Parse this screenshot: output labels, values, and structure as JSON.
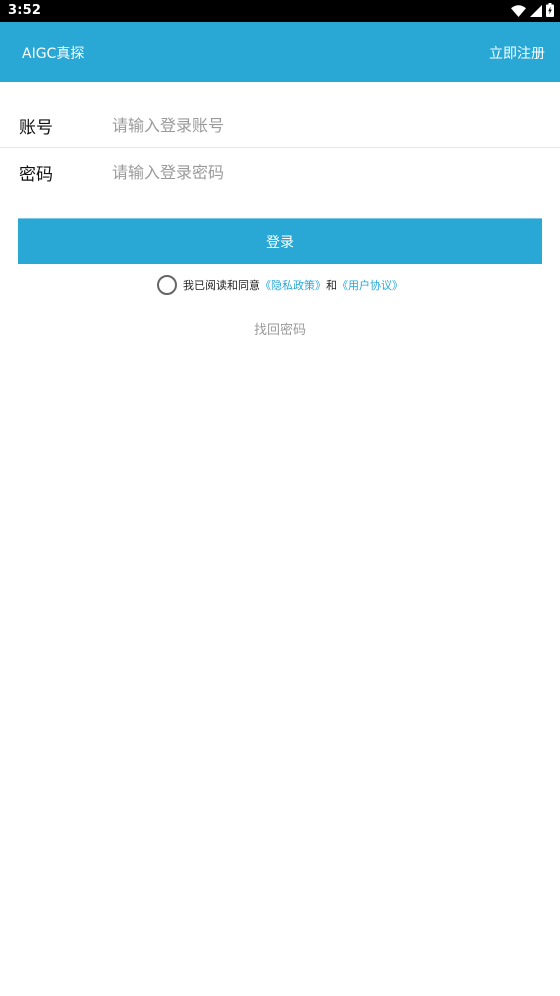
{
  "status_bar": {
    "time": "3:52",
    "icons": [
      "wifi-icon",
      "signal-icon",
      "battery-icon"
    ]
  },
  "app_bar": {
    "title": "AIGC真探",
    "register_label": "立即注册"
  },
  "form": {
    "account": {
      "label": "账号",
      "placeholder": "请输入登录账号",
      "value": ""
    },
    "password": {
      "label": "密码",
      "placeholder": "请输入登录密码",
      "value": ""
    }
  },
  "login_button": "登录",
  "agreement": {
    "checked": false,
    "prefix": "我已阅读和同意",
    "privacy_link": "《隐私政策》",
    "conjunction": "和",
    "user_agreement_link": "《用户协议》"
  },
  "forgot_password": "找回密码",
  "colors": {
    "primary": "#29a8d6",
    "placeholder": "#9a9a9a",
    "status_bar": "#000000"
  }
}
